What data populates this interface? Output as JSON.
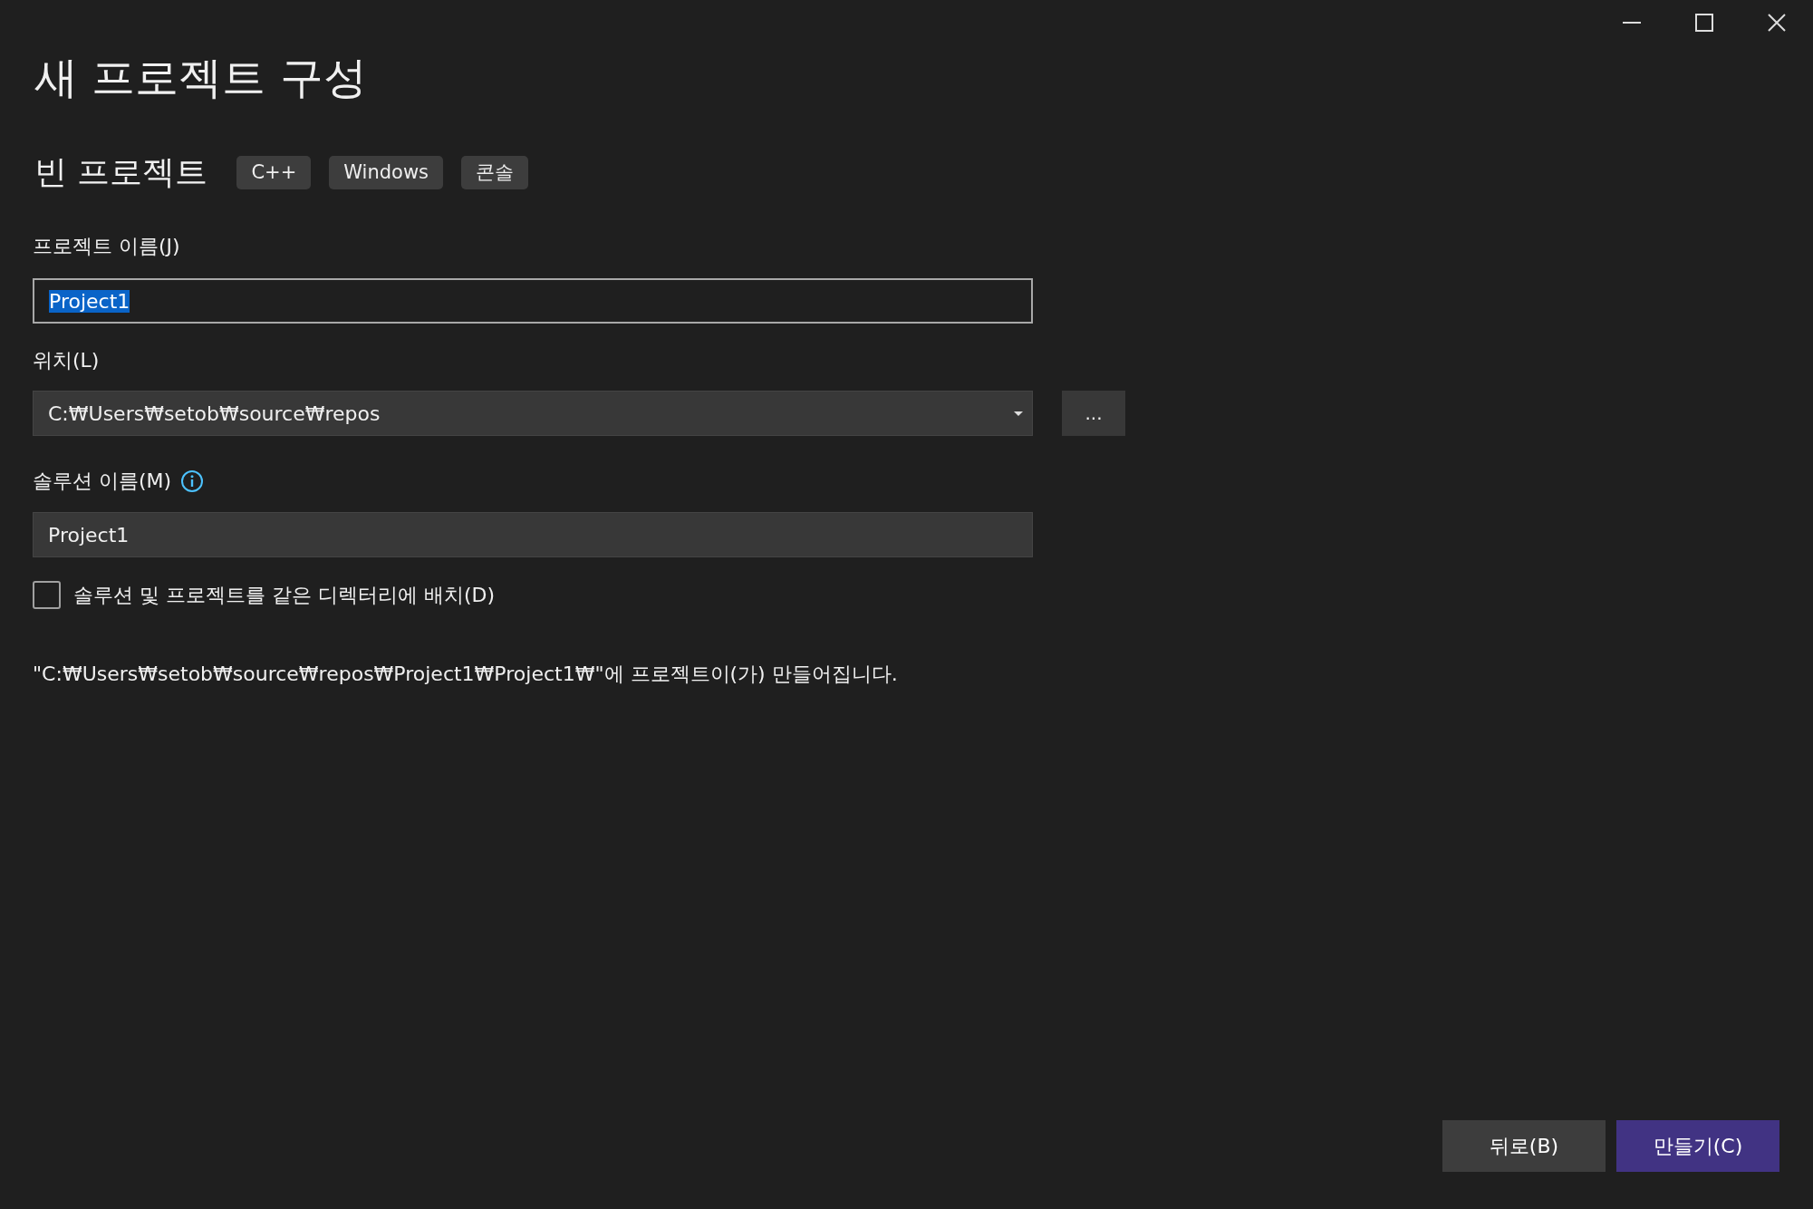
{
  "window": {
    "title": "새 프로젝트 구성"
  },
  "template": {
    "name": "빈 프로젝트",
    "tags": [
      "C++",
      "Windows",
      "콘솔"
    ]
  },
  "project_name": {
    "label": "프로젝트 이름(J)",
    "value": "Project1",
    "text_selected": true
  },
  "location": {
    "label": "위치(L)",
    "value": "C:₩Users₩setob₩source₩repos",
    "browse_button": "..."
  },
  "solution_name": {
    "label": "솔루션 이름(M)",
    "value": "Project1"
  },
  "same_directory": {
    "label": "솔루션 및 프로젝트를 같은 디렉터리에 배치(D)",
    "checked": false
  },
  "output_path": "\"C:₩Users₩setob₩source₩repos₩Project1₩Project1₩\"에 프로젝트이(가) 만들어집니다.",
  "buttons": [
    {
      "label": "뒤로(B)",
      "kind": "secondary"
    },
    {
      "label": "만들기(C)",
      "kind": "primary"
    }
  ]
}
